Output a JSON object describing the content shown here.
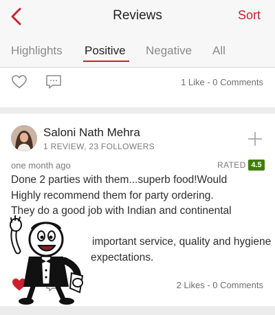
{
  "header": {
    "title": "Reviews",
    "sort_label": "Sort",
    "back_icon": "chevron-left-icon",
    "accent_color": "#cb202d"
  },
  "tabs": [
    {
      "label": "Highlights",
      "active": false
    },
    {
      "label": "Positive",
      "active": true
    },
    {
      "label": "Negative",
      "active": false
    },
    {
      "label": "All",
      "active": false
    }
  ],
  "previous_review": {
    "like_icon": "heart-outline-icon",
    "comment_icon": "comment-icon",
    "stats": "1 Like - 0 Comments"
  },
  "review": {
    "author": "Saloni Nath Mehra",
    "author_meta": "1 REVIEW, 23 FOLLOWERS",
    "follow_icon": "plus-icon",
    "time": "one month ago",
    "rated_label": "RATED",
    "rating": "4.5",
    "rating_color": "#3f7e00",
    "text_lines": [
      "Done 2 parties with them...superb food!Would",
      "Highly recommend them for party ordering.",
      "They do a good job with Indian and continental",
      "",
      "important service, quality and hygiene",
      "expectations."
    ],
    "stats": "2 Likes - 0 Comments"
  },
  "overlay": {
    "icon": "cartoon-waiter-mascot-icon"
  }
}
